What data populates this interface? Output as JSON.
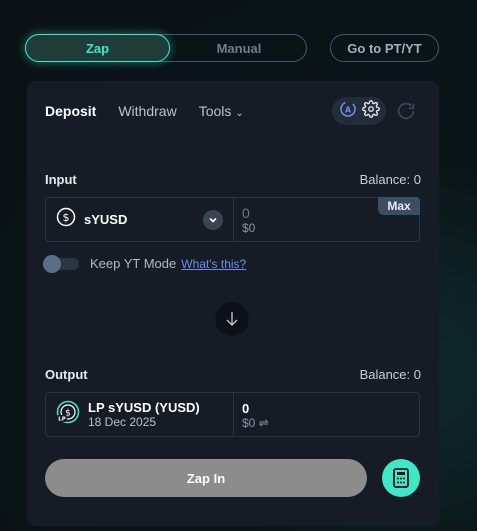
{
  "mode_tabs": {
    "zap": "Zap",
    "manual": "Manual"
  },
  "go_button": "Go to PT/YT",
  "tabs": {
    "deposit": "Deposit",
    "withdraw": "Withdraw",
    "tools": "Tools"
  },
  "input": {
    "label": "Input",
    "balance": "Balance: 0",
    "token": "sYUSD",
    "amount": "0",
    "usd": "$0",
    "max_label": "Max"
  },
  "yt_mode": {
    "label": "Keep YT Mode",
    "help_link": "What's this?",
    "enabled": false
  },
  "output": {
    "label": "Output",
    "balance": "Balance: 0",
    "token": "LP sYUSD (YUSD)",
    "date": "18 Dec 2025",
    "amount": "0",
    "usd": "$0 ⇌"
  },
  "zap_in_button": "Zap In",
  "colors": {
    "accent": "#3de8c8",
    "card": "#161c25",
    "link": "#6f8cf0"
  },
  "icons": [
    "settings-icon",
    "auto-icon",
    "refresh-icon",
    "dollar-token-icon",
    "chevron-down-icon",
    "arrow-down-icon",
    "lp-token-icon",
    "calculator-icon"
  ]
}
